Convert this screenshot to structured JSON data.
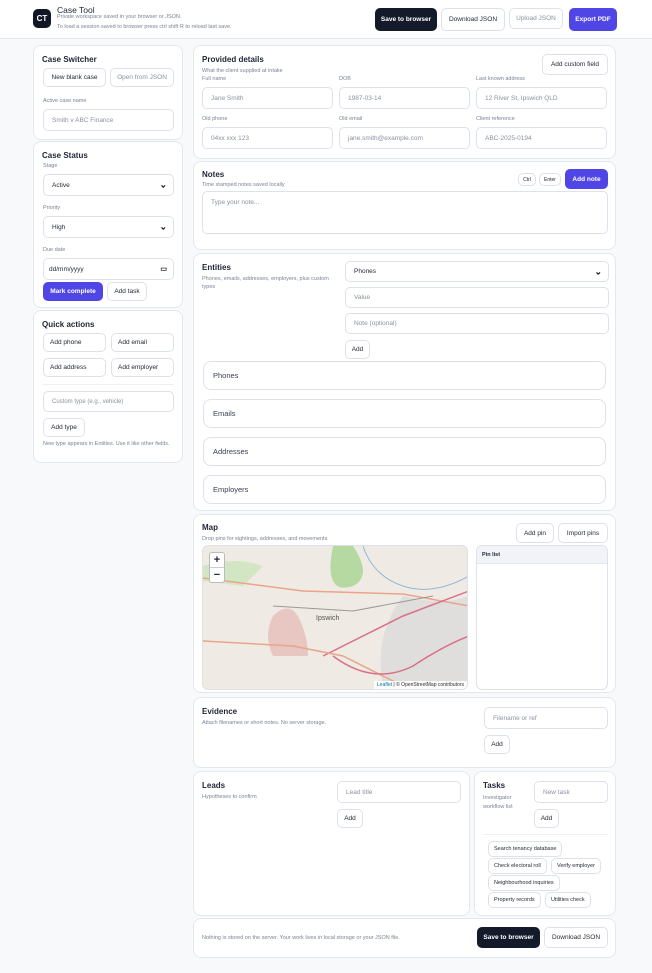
{
  "header": {
    "logo": "CT",
    "title": "Case Tool",
    "subtitle1": "Private workspace saved in your browser or JSON.",
    "subtitle2": "To load a session saved to browser press ctrl shift R to reload last save.",
    "save": "Save to browser",
    "download": "Download JSON",
    "upload": "Upload JSON",
    "export": "Export PDF"
  },
  "switcher": {
    "title": "Case Switcher",
    "new": "New blank case",
    "open": "Open from JSON",
    "name_label": "Active case name",
    "name_value": "Smith v ABC Finance"
  },
  "status": {
    "title": "Case Status",
    "stage_label": "Stage",
    "stage": "Active",
    "priority_label": "Priority",
    "priority": "High",
    "due_label": "Due date",
    "due": "dd/mm/yyyy",
    "complete": "Mark complete",
    "add_task": "Add task"
  },
  "quick": {
    "title": "Quick actions",
    "phone": "Add phone",
    "email": "Add email",
    "address": "Add address",
    "employer": "Add employer",
    "custom_placeholder": "Custom type (e.g., vehicle)",
    "add_type": "Add type",
    "hint": "New type appears in Entities. Use it like other fields."
  },
  "details": {
    "title": "Provided details",
    "subtitle": "What the client supplied at intake",
    "add_field": "Add custom field",
    "fields": [
      {
        "label": "Full name",
        "value": "Jane Smith"
      },
      {
        "label": "DOB",
        "value": "1987-03-14"
      },
      {
        "label": "Last known address",
        "value": "12 River St, Ipswich QLD"
      },
      {
        "label": "Old phone",
        "value": "04xx xxx 123"
      },
      {
        "label": "Old email",
        "value": "jane.smith@example.com"
      },
      {
        "label": "Client reference",
        "value": "ABC-2025-0194"
      }
    ]
  },
  "notes": {
    "title": "Notes",
    "subtitle": "Time stamped notes saved locally",
    "ctrl": "Ctrl",
    "enter": "Enter",
    "add": "Add note",
    "placeholder": "Type your note..."
  },
  "entities": {
    "title": "Entities",
    "subtitle": "Phones, emails, addresses, employers, plus custom types",
    "type": "Phones",
    "value_placeholder": "Value",
    "note_placeholder": "Note (optional)",
    "add": "Add",
    "groups": [
      "Phones",
      "Emails",
      "Addresses",
      "Employers"
    ]
  },
  "map": {
    "title": "Map",
    "subtitle": "Drop pins for sightings, addresses, and movements",
    "add_pin": "Add pin",
    "import": "Import pins",
    "place": "Ipswich",
    "zoom_in": "+",
    "zoom_out": "−",
    "attribution_link": "Leaflet",
    "attribution": "| © OpenStreetMap contributors",
    "pin_list": "Pin list"
  },
  "evidence": {
    "title": "Evidence",
    "subtitle": "Attach filenames or short notes. No server storage.",
    "placeholder": "Filename or ref",
    "add": "Add"
  },
  "leads": {
    "title": "Leads",
    "subtitle": "Hypotheses to confirm",
    "placeholder": "Lead title",
    "add": "Add"
  },
  "tasks": {
    "title": "Tasks",
    "subtitle": "Investigator workflow list",
    "placeholder": "New task",
    "add": "Add",
    "items": [
      "Search tenancy database",
      "Check electoral roll",
      "Verify employer",
      "Neighbourhood inquiries",
      "Property records",
      "Utilities check"
    ]
  },
  "footer": {
    "text": "Nothing is stored on the server. Your work lives in local storage or your JSON file.",
    "save": "Save to browser",
    "download": "Download JSON"
  },
  "colors": {
    "accent": "#4f46e5",
    "dark": "#131a2a"
  }
}
